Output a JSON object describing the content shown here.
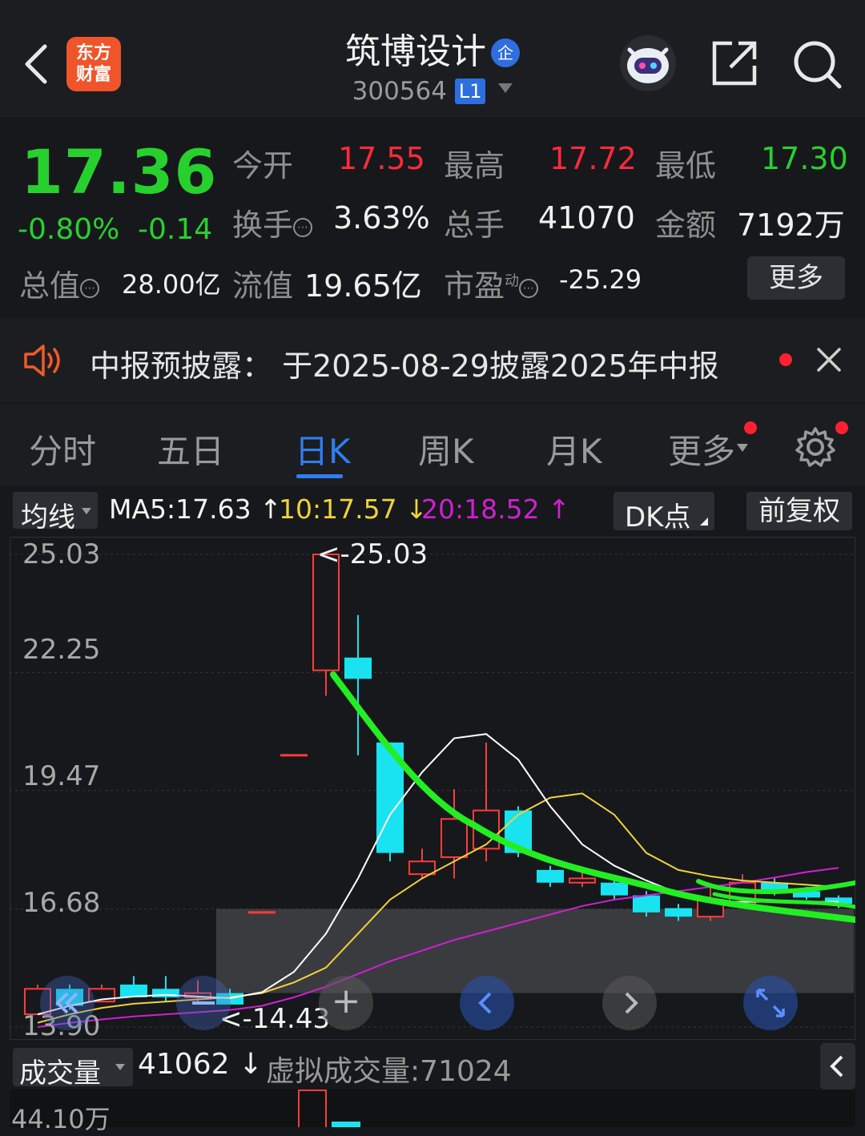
{
  "header": {
    "logo_line1": "东方",
    "logo_line2": "财富",
    "stock_name": "筑博设计",
    "qy_badge": "企",
    "stock_code": "300564",
    "level_badge": "L1"
  },
  "quote": {
    "price": "17.36",
    "change_pct": "-0.80%",
    "change_abs": "-0.14",
    "open_label": "今开",
    "open_value": "17.55",
    "high_label": "最高",
    "high_value": "17.72",
    "low_label": "最低",
    "low_value": "17.30",
    "turnover_label": "换手",
    "turnover_value": "3.63%",
    "volume_label": "总手",
    "volume_value": "41070",
    "amount_label": "金额",
    "amount_value": "7192万",
    "mcap_label": "总值",
    "mcap_value": "28.00亿",
    "float_label": "流值",
    "float_value": "19.65亿",
    "pe_label": "市盈",
    "pe_super": "动",
    "pe_value": "-25.29",
    "more_button": "更多"
  },
  "notice": {
    "text": "中报预披露：  于2025-08-29披露2025年中报"
  },
  "tabs": [
    {
      "label": "分时"
    },
    {
      "label": "五日"
    },
    {
      "label": "日K"
    },
    {
      "label": "周K"
    },
    {
      "label": "月K"
    },
    {
      "label": "更多"
    }
  ],
  "ma_bar": {
    "indicator_select": "均线",
    "ma5": "MA5:17.63",
    "ma10": "10:17.57",
    "ma20": "20:18.52",
    "dk_button": "DK点",
    "adjust_button": "前复权"
  },
  "chart_data": {
    "type": "candlestick",
    "y_ticks": [
      "25.03",
      "22.25",
      "19.47",
      "16.68",
      "13.90"
    ],
    "high_marker": "<-25.03",
    "low_marker": "<-14.43",
    "colors": {
      "up": "#ff3b3b",
      "down": "#19e3f0",
      "ma5": "#ffffff",
      "ma10": "#f0d23a",
      "ma20": "#d21fd2",
      "annotation": "#22ee22"
    },
    "candles": [
      {
        "open": 14.2,
        "close": 14.8,
        "high": 14.9,
        "low": 14.2
      },
      {
        "open": 14.8,
        "close": 14.4,
        "high": 14.9,
        "low": 14.3
      },
      {
        "open": 14.5,
        "close": 14.8,
        "high": 14.9,
        "low": 14.5
      },
      {
        "open": 14.9,
        "close": 14.6,
        "high": 15.1,
        "low": 14.6
      },
      {
        "open": 14.8,
        "close": 14.6,
        "high": 15.1,
        "low": 14.5
      },
      {
        "open": 14.6,
        "close": 14.7,
        "high": 15.0,
        "low": 14.5
      },
      {
        "open": 14.7,
        "close": 14.43,
        "high": 14.8,
        "low": 14.43
      },
      {
        "open": 16.6,
        "close": 16.6,
        "high": 16.6,
        "low": 16.6
      },
      {
        "open": 20.3,
        "close": 20.3,
        "high": 20.3,
        "low": 20.3
      },
      {
        "open": 22.3,
        "close": 25.03,
        "high": 25.03,
        "low": 21.7
      },
      {
        "open": 22.6,
        "close": 22.1,
        "high": 23.6,
        "low": 20.3
      },
      {
        "open": 20.6,
        "close": 18.0,
        "high": 20.6,
        "low": 17.8
      },
      {
        "open": 17.5,
        "close": 17.8,
        "high": 18.1,
        "low": 17.4
      },
      {
        "open": 17.9,
        "close": 18.8,
        "high": 19.5,
        "low": 17.4
      },
      {
        "open": 18.1,
        "close": 19.0,
        "high": 20.6,
        "low": 17.8
      },
      {
        "open": 19.0,
        "close": 18.0,
        "high": 19.1,
        "low": 17.9
      },
      {
        "open": 17.6,
        "close": 17.3,
        "high": 17.7,
        "low": 17.2
      },
      {
        "open": 17.3,
        "close": 17.4,
        "high": 17.6,
        "low": 17.2
      },
      {
        "open": 17.3,
        "close": 17.0,
        "high": 17.4,
        "low": 16.9
      },
      {
        "open": 17.0,
        "close": 16.6,
        "high": 17.1,
        "low": 16.5
      },
      {
        "open": 16.7,
        "close": 16.5,
        "high": 16.8,
        "low": 16.4
      },
      {
        "open": 16.5,
        "close": 16.9,
        "high": 17.2,
        "low": 16.4
      },
      {
        "open": 16.8,
        "close": 17.3,
        "high": 17.5,
        "low": 16.7
      },
      {
        "open": 17.3,
        "close": 17.1,
        "high": 17.4,
        "low": 17.0
      },
      {
        "open": 17.1,
        "close": 16.95,
        "high": 17.2,
        "low": 16.9
      },
      {
        "open": 16.95,
        "close": 16.8,
        "high": 17.0,
        "low": 16.7
      }
    ],
    "ma5": [
      14.2,
      14.4,
      14.55,
      14.62,
      14.66,
      14.62,
      14.58,
      14.72,
      15.2,
      16.1,
      17.4,
      18.9,
      19.9,
      20.7,
      20.8,
      20.2,
      19.1,
      18.2,
      17.7,
      17.35,
      17.05,
      16.85,
      16.85,
      16.85,
      16.85,
      16.85
    ],
    "ma10": [
      14.0,
      14.2,
      14.35,
      14.45,
      14.5,
      14.55,
      14.6,
      14.7,
      14.95,
      15.3,
      16.1,
      16.9,
      17.4,
      17.8,
      18.2,
      18.9,
      19.3,
      19.4,
      18.9,
      18.0,
      17.6,
      17.45,
      17.35,
      17.3,
      17.25,
      17.2
    ],
    "ma20": [
      13.9,
      14.0,
      14.08,
      14.15,
      14.2,
      14.25,
      14.3,
      14.4,
      14.6,
      14.85,
      15.15,
      15.45,
      15.7,
      15.95,
      16.15,
      16.35,
      16.55,
      16.75,
      16.9,
      17.0,
      17.1,
      17.2,
      17.3,
      17.42,
      17.55,
      17.65
    ]
  },
  "chart_controls": {
    "zoom_in": "+",
    "prev": "<",
    "next": ">",
    "fullscreen": "expand"
  },
  "volume_bar": {
    "indicator_select": "成交量",
    "value": "41062",
    "virtual_label": "虚拟成交量:71024",
    "y_top": "44.10万"
  }
}
